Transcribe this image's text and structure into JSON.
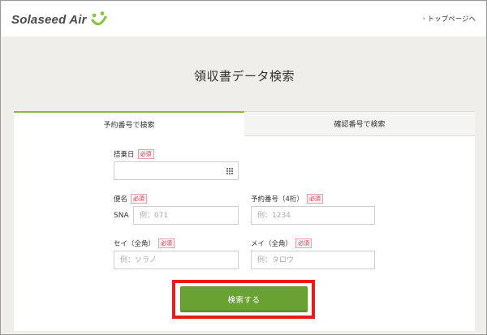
{
  "header": {
    "logo_text": "Solaseed Air",
    "top_link": "トップページへ"
  },
  "page": {
    "title": "領収書データ検索"
  },
  "tabs": [
    {
      "label": "予約番号で検索",
      "active": true
    },
    {
      "label": "確認番号で検索",
      "active": false
    }
  ],
  "form": {
    "required_badge": "必須",
    "boarding_date": {
      "label": "搭乗日",
      "value": ""
    },
    "flight_name": {
      "label": "便名",
      "prefix": "SNA",
      "placeholder": "例：071"
    },
    "reservation_number": {
      "label": "予約番号（4桁）",
      "placeholder": "例：1234"
    },
    "sei": {
      "label": "セイ（全角）",
      "placeholder": "例：ソラノ"
    },
    "mei": {
      "label": "メイ（全角）",
      "placeholder": "例：タロウ"
    },
    "submit_label": "検索する"
  },
  "colors": {
    "accent_green": "#6aa133",
    "tab_active_border": "#8cb73f",
    "required_red": "#d6334a",
    "highlight_red": "#e41c1c",
    "background": "#efeeea"
  }
}
